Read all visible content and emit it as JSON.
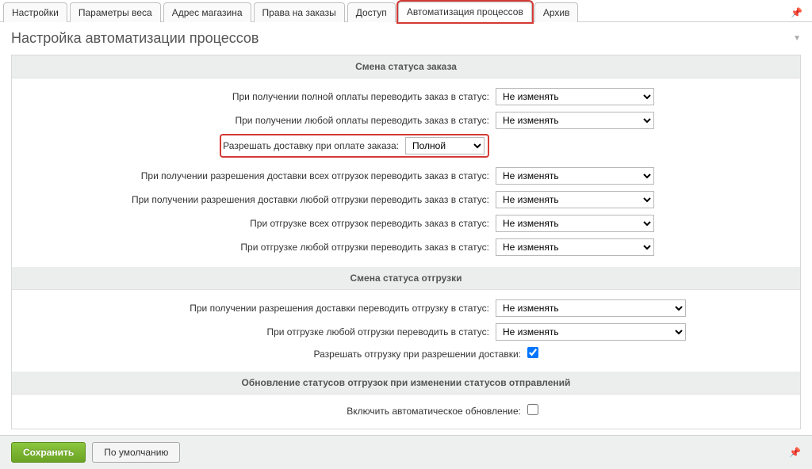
{
  "tabs": {
    "item0": "Настройки",
    "item1": "Параметры веса",
    "item2": "Адрес магазина",
    "item3": "Права на заказы",
    "item4": "Доступ",
    "item5": "Автоматизация процессов",
    "item6": "Архив"
  },
  "section_title": "Настройка автоматизации процессов",
  "groups": {
    "g1": {
      "header": "Смена статуса заказа",
      "rows": {
        "r1": {
          "label": "При получении полной оплаты переводить заказ в статус:",
          "value": "Не изменять"
        },
        "r2": {
          "label": "При получении любой оплаты переводить заказ в статус:",
          "value": "Не изменять"
        },
        "r3": {
          "label": "Разрешать доставку при оплате заказа:",
          "value": "Полной"
        },
        "r4": {
          "label": "При получении разрешения доставки всех отгрузок переводить заказ в статус:",
          "value": "Не изменять"
        },
        "r5": {
          "label": "При получении разрешения доставки любой отгрузки переводить заказ в статус:",
          "value": "Не изменять"
        },
        "r6": {
          "label": "При отгрузке всех отгрузок переводить заказ в статус:",
          "value": "Не изменять"
        },
        "r7": {
          "label": "При отгрузке любой отгрузки переводить заказ в статус:",
          "value": "Не изменять"
        }
      }
    },
    "g2": {
      "header": "Смена статуса отгрузки",
      "rows": {
        "r1": {
          "label": "При получении разрешения доставки переводить отгрузку в статус:",
          "value": "Не изменять"
        },
        "r2": {
          "label": "При отгрузке любой отгрузки переводить в статус:",
          "value": "Не изменять"
        },
        "r3": {
          "label": "Разрешать отгрузку при разрешении доставки:"
        }
      }
    },
    "g3": {
      "header": "Обновление статусов отгрузок при изменении статусов отправлений",
      "rows": {
        "r1": {
          "label": "Включить автоматическое обновление:"
        }
      }
    }
  },
  "buttons": {
    "save": "Сохранить",
    "default": "По умолчанию"
  },
  "icons": {
    "pin": "📌",
    "collapse": "▼"
  }
}
